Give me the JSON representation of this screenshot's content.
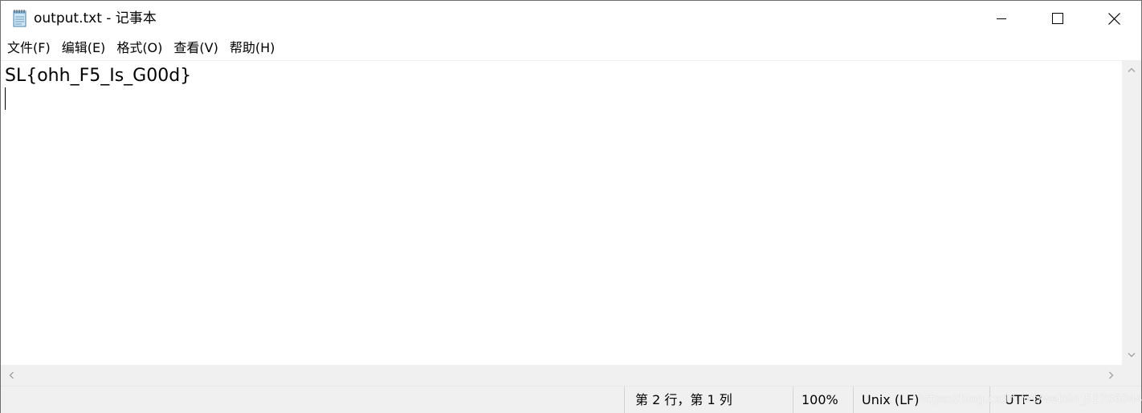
{
  "window": {
    "title": "output.txt - 记事本",
    "app_icon": "notepad-icon",
    "controls": {
      "minimize_icon": "minimize-icon",
      "maximize_icon": "maximize-icon",
      "close_icon": "close-icon"
    }
  },
  "menu": {
    "items": [
      {
        "label": "文件(F)"
      },
      {
        "label": "编辑(E)"
      },
      {
        "label": "格式(O)"
      },
      {
        "label": "查看(V)"
      },
      {
        "label": "帮助(H)"
      }
    ]
  },
  "editor": {
    "content": "SL{ohh_F5_Is_G00d}"
  },
  "status": {
    "position": "第 2 行，第 1 列",
    "zoom": "100%",
    "line_ending": "Unix (LF)",
    "encoding": "UTF-8"
  },
  "watermark": {
    "text": "https://blog.csdn.net/weixin_51706044"
  },
  "colors": {
    "chrome_bg": "#f0f0f0",
    "window_border": "#6e6e6e"
  }
}
